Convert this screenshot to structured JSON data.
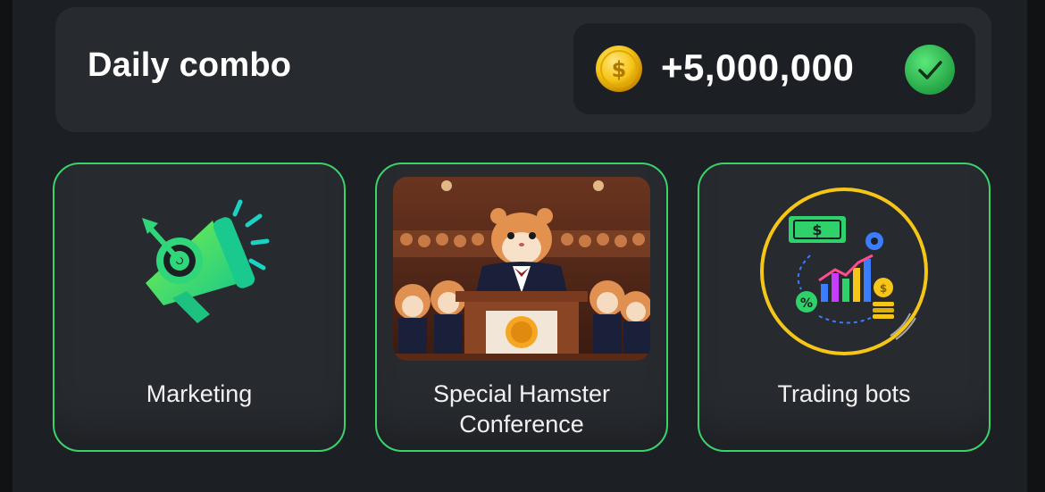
{
  "combo": {
    "title": "Daily combo",
    "reward": "+5,000,000",
    "coin_icon": "coin-icon",
    "status_icon": "check-circle-icon"
  },
  "cards": [
    {
      "label": "Marketing",
      "icon": "megaphone-target-icon"
    },
    {
      "label": "Special Hamster Conference",
      "line1": "Special Hamster",
      "line2": "Conference",
      "icon": "hamster-conference-image"
    },
    {
      "label": "Trading bots",
      "icon": "trading-bots-icon"
    }
  ],
  "colors": {
    "accent_green": "#3ad36b",
    "card_bg": "#272a2f",
    "panel_bg": "#1c1f24",
    "coin_gold": "#f5c518"
  }
}
